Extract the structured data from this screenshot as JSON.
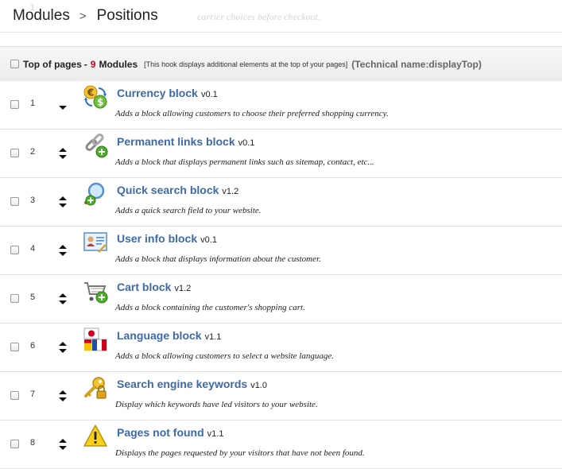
{
  "ghost": {
    "position": "1",
    "description": "carrier choices before checkout."
  },
  "breadcrumb": {
    "items": [
      "Modules",
      "Positions"
    ],
    "separator": ">"
  },
  "hook": {
    "name": "Top of pages",
    "dash": "-",
    "count": "9",
    "modules_label": "Modules",
    "description": "[This hook displays additional elements at the top of your pages]",
    "technical_name": "(Technical name:displayTop)"
  },
  "modules": [
    {
      "position": "1",
      "title": "Currency block",
      "version": "v0.1",
      "description": "Adds a block allowing customers to choose their preferred shopping currency.",
      "icon": "currency-exchange-icon"
    },
    {
      "position": "2",
      "title": "Permanent links block",
      "version": "v0.1",
      "description": "Adds a block that displays permanent links such as sitemap, contact, etc...",
      "icon": "chain-link-icon"
    },
    {
      "position": "3",
      "title": "Quick search block",
      "version": "v1.2",
      "description": "Adds a quick search field to your website.",
      "icon": "magnifier-icon"
    },
    {
      "position": "4",
      "title": "User info block",
      "version": "v0.1",
      "description": "Adds a block that displays information about the customer.",
      "icon": "user-card-icon"
    },
    {
      "position": "5",
      "title": "Cart block",
      "version": "v1.2",
      "description": "Adds a block containing the customer's shopping cart.",
      "icon": "shopping-cart-icon"
    },
    {
      "position": "6",
      "title": "Language block",
      "version": "v1.1",
      "description": "Adds a block allowing customers to select a website language.",
      "icon": "flags-icon"
    },
    {
      "position": "7",
      "title": "Search engine keywords",
      "version": "v1.0",
      "description": "Display which keywords have led visitors to your website.",
      "icon": "key-lock-icon"
    },
    {
      "position": "8",
      "title": "Pages not found",
      "version": "v1.1",
      "description": "Displays the pages requested by your visitors that have not been found.",
      "icon": "warning-icon"
    }
  ],
  "colors": {
    "accent_link": "#3e6aaa",
    "count_red": "#d0021b",
    "header_bg": "#efefef"
  }
}
